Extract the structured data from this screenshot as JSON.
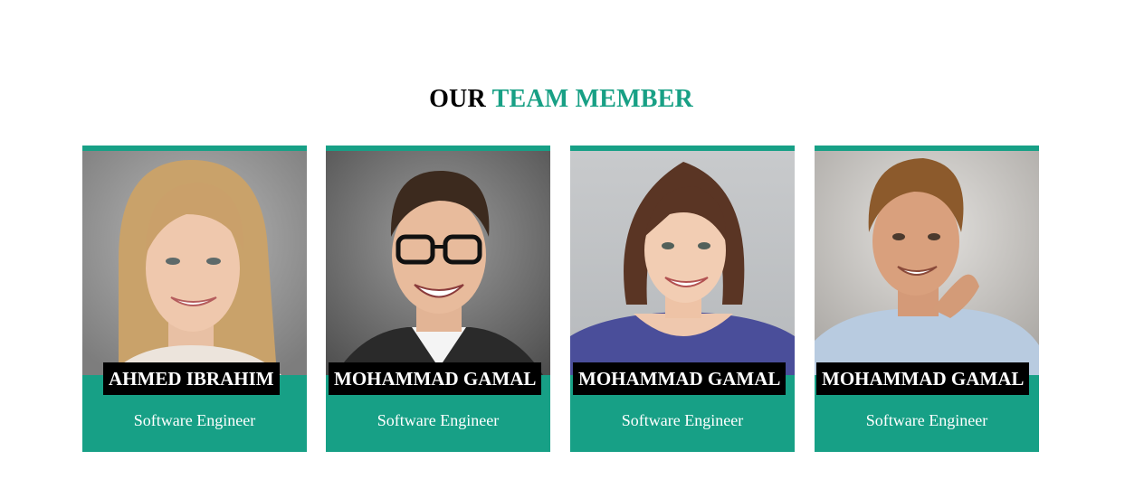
{
  "section": {
    "title_part1": "OUR",
    "title_part2": "TEAM MEMBER"
  },
  "colors": {
    "accent": "#17a086",
    "name_bg": "#000000",
    "text_light": "#ffffff"
  },
  "members": [
    {
      "name": "AHMED IBRAHIM",
      "role": "Software Engineer",
      "photo": "portrait-woman-blonde"
    },
    {
      "name": "MOHAMMAD GAMAL",
      "role": "Software Engineer",
      "photo": "portrait-man-glasses"
    },
    {
      "name": "MOHAMMAD GAMAL",
      "role": "Software Engineer",
      "photo": "portrait-woman-brunette"
    },
    {
      "name": "MOHAMMAD GAMAL",
      "role": "Software Engineer",
      "photo": "portrait-man-hand-chin"
    }
  ]
}
